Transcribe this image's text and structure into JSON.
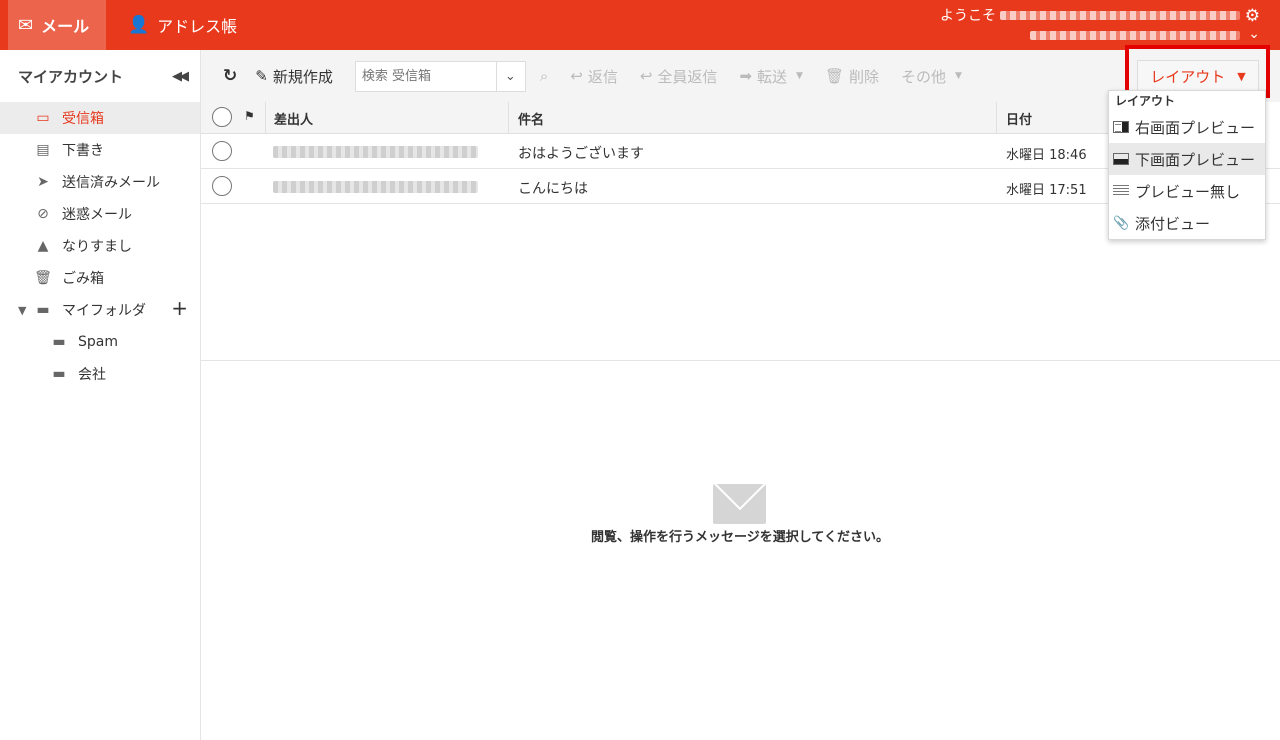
{
  "topbar": {
    "mail_tab": "メール",
    "address_tab": "アドレス帳",
    "welcome": "ようこそ"
  },
  "sidebar": {
    "title": "マイアカウント",
    "folders": [
      {
        "label": "受信箱"
      },
      {
        "label": "下書き"
      },
      {
        "label": "送信済みメール"
      },
      {
        "label": "迷惑メール"
      },
      {
        "label": "なりすまし"
      },
      {
        "label": "ごみ箱"
      },
      {
        "label": "マイフォルダ"
      },
      {
        "label": "Spam"
      },
      {
        "label": "会社"
      }
    ]
  },
  "toolbar": {
    "new": "新規作成",
    "search_placeholder": "検索 受信箱",
    "reply": "返信",
    "reply_all": "全員返信",
    "forward": "転送",
    "delete": "削除",
    "more": "その他",
    "layout": "レイアウト"
  },
  "layout_menu": {
    "header": "レイアウト",
    "items": [
      {
        "label": "右画面プレビュー"
      },
      {
        "label": "下画面プレビュー"
      },
      {
        "label": "プレビュー無し"
      },
      {
        "label": "添付ビュー"
      }
    ]
  },
  "list": {
    "columns": {
      "sender": "差出人",
      "subject": "件名",
      "date": "日付"
    },
    "rows": [
      {
        "subject": "おはようございます",
        "date": "水曜日 18:46"
      },
      {
        "subject": "こんにちは",
        "date": "水曜日 17:51"
      }
    ]
  },
  "preview": {
    "empty_message": "閲覧、操作を行うメッセージを選択してください。"
  },
  "colors": {
    "accent": "#e8391c",
    "highlight": "#e30000"
  }
}
